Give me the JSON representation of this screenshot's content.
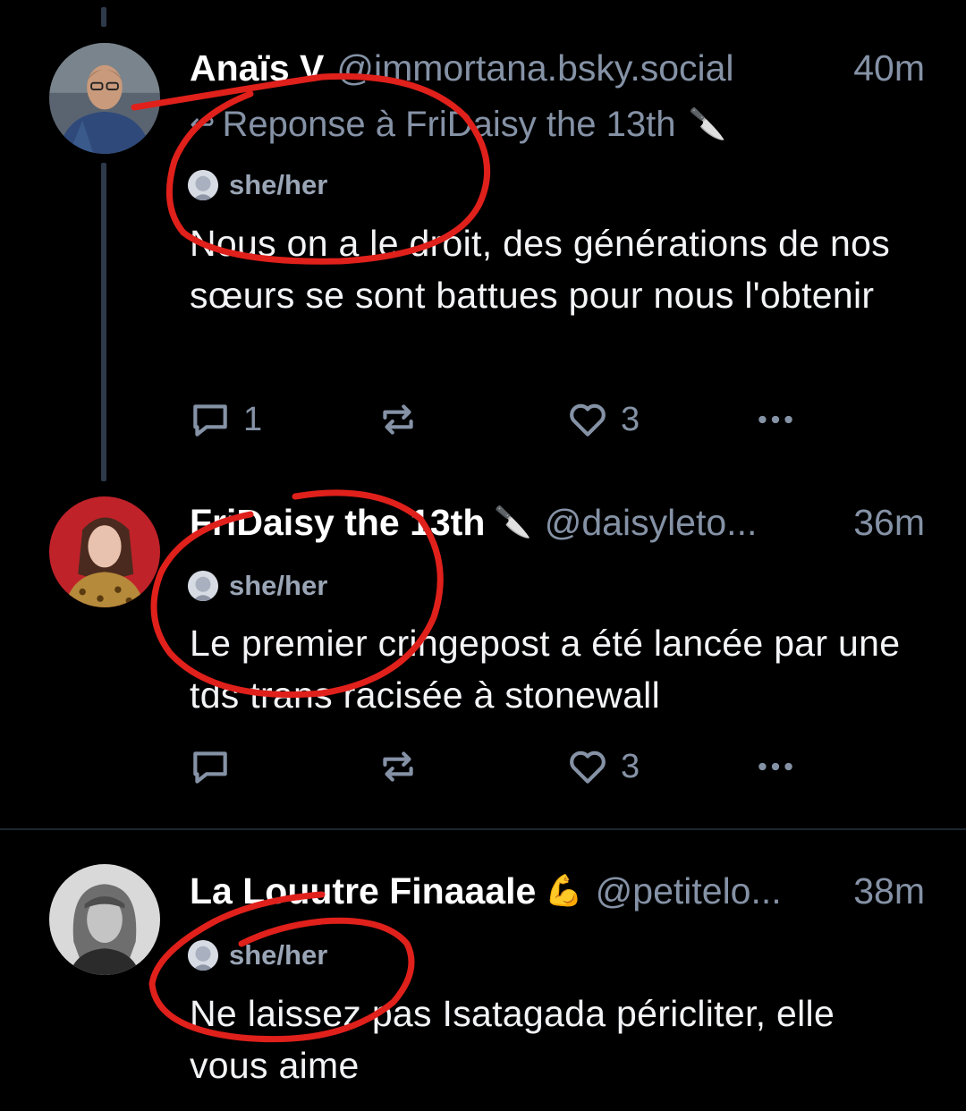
{
  "posts": [
    {
      "display_name": "Anaïs V",
      "handle": "@immortana.bsky.social",
      "time": "40m",
      "reply_to": "Reponse à FriDaisy the 13th",
      "pronouns": "she/her",
      "text": "Nous on a le droit, des générations de nos sœurs se sont battues pour nous l'obtenir",
      "reply_count": "1",
      "like_count": "3"
    },
    {
      "display_name": "FriDaisy the 13th",
      "handle": "@daisyleto...",
      "time": "36m",
      "pronouns": "she/her",
      "text": "Le premier cringepost a été lancée par une tds trans racisée à stonewall",
      "reply_count": "",
      "like_count": "3"
    },
    {
      "display_name": "La Louutre Finaaale",
      "handle": "@petitelo...",
      "time": "38m",
      "pronouns": "she/her",
      "text": "Ne laissez pas Isatagada péricliter, elle vous aime"
    }
  ],
  "icons": {
    "reply_arrow": "reply-arrow-icon",
    "knife": "kitchen-knife-icon",
    "flexed_biceps": "flexed-biceps-icon",
    "comment": "comment-icon",
    "repost": "repost-icon",
    "like": "heart-icon",
    "more": "more-options-icon"
  },
  "colors": {
    "background": "#000000",
    "secondary_text": "#8592a6",
    "thread_line": "#2e3a4a",
    "annotation_red": "#e0201b"
  }
}
